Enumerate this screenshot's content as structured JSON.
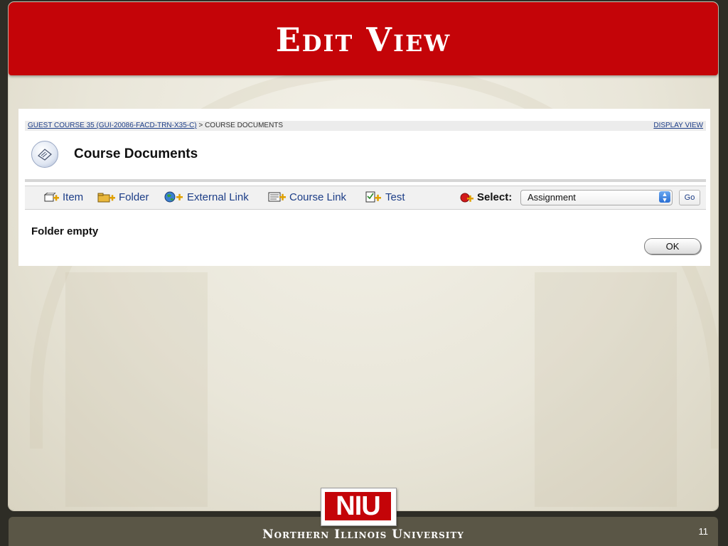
{
  "slide": {
    "title": "Edit View",
    "footer": "Northern Illinois University",
    "page_number": "11",
    "logo_text": "NIU"
  },
  "breadcrumb": {
    "course_link": "GUEST COURSE 35 (GUI-20086-FACD-TRN-X35-C)",
    "separator": ">",
    "current": "COURSE DOCUMENTS",
    "display_view": "DISPLAY VIEW"
  },
  "page": {
    "title": "Course Documents",
    "empty_message": "Folder empty",
    "ok_label": "OK"
  },
  "toolbar": {
    "items": [
      {
        "label": "Item",
        "icon": "item-add-icon"
      },
      {
        "label": "Folder",
        "icon": "folder-add-icon"
      },
      {
        "label": "External Link",
        "icon": "globe-add-icon"
      },
      {
        "label": "Course Link",
        "icon": "course-link-add-icon"
      },
      {
        "label": "Test",
        "icon": "test-add-icon"
      }
    ],
    "select_label": "Select:",
    "select_value": "Assignment",
    "go_label": "Go"
  },
  "colors": {
    "title_red": "#c40408",
    "link_blue": "#1c3d87",
    "footer_brown": "#5a5646"
  }
}
